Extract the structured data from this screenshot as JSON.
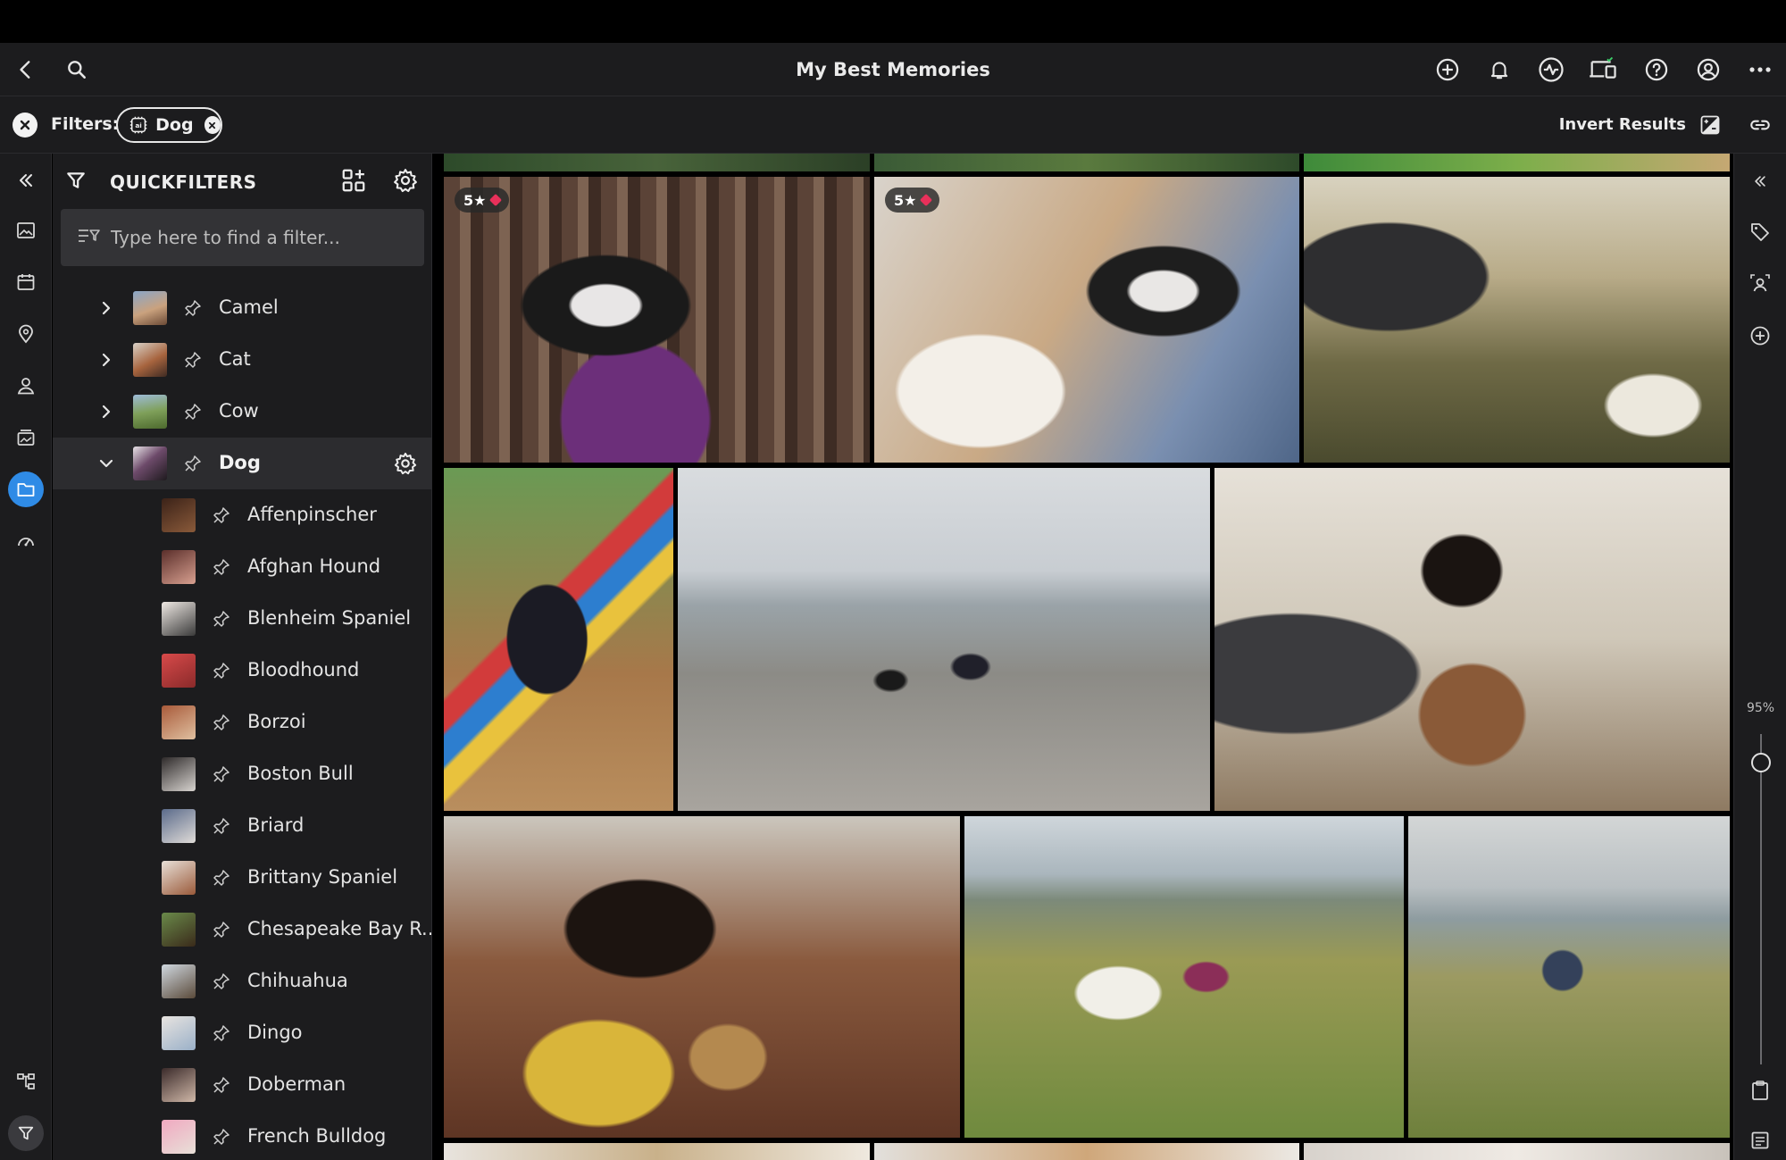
{
  "header": {
    "title": "My Best Memories",
    "left_icons": [
      "back-icon",
      "search-icon"
    ],
    "right_icons": [
      "add-icon",
      "bell-icon",
      "activity-icon",
      "devices-icon",
      "help-icon",
      "account-icon",
      "more-icon"
    ]
  },
  "filters": {
    "label": "Filters:",
    "chip_label": "Dog",
    "chip_icon": "ai-icon",
    "invert_label": "Invert Results"
  },
  "left_rail": {
    "items": [
      "collapse-icon",
      "photos-icon",
      "calendar-icon",
      "location-icon",
      "person-icon",
      "albums-icon",
      "folder-icon",
      "dashboard-icon"
    ],
    "active": "folder-icon",
    "bottom": [
      "hierarchy-icon",
      "filter-icon"
    ]
  },
  "quickfilters": {
    "title": "QUICKFILTERS",
    "search_placeholder": "Type here to find a filter...",
    "categories": [
      {
        "label": "Camel",
        "expanded": false
      },
      {
        "label": "Cat",
        "expanded": false
      },
      {
        "label": "Cow",
        "expanded": false
      },
      {
        "label": "Dog",
        "expanded": true
      }
    ],
    "dog_children": [
      "Affenpinscher",
      "Afghan Hound",
      "Blenheim Spaniel",
      "Bloodhound",
      "Borzoi",
      "Boston Bull",
      "Briard",
      "Brittany Spaniel",
      "Chesapeake Bay R...",
      "Chihuahua",
      "Dingo",
      "Doberman",
      "French Bulldog"
    ]
  },
  "gallery": {
    "badges": [
      "5★",
      "5★"
    ]
  },
  "right_rail": {
    "zoom_label": "95%",
    "zoom_value": 0.95
  },
  "colors": {
    "accent": "#2f8be6",
    "panel": "#1c1c1e",
    "rating_tag": "#e8305a"
  }
}
